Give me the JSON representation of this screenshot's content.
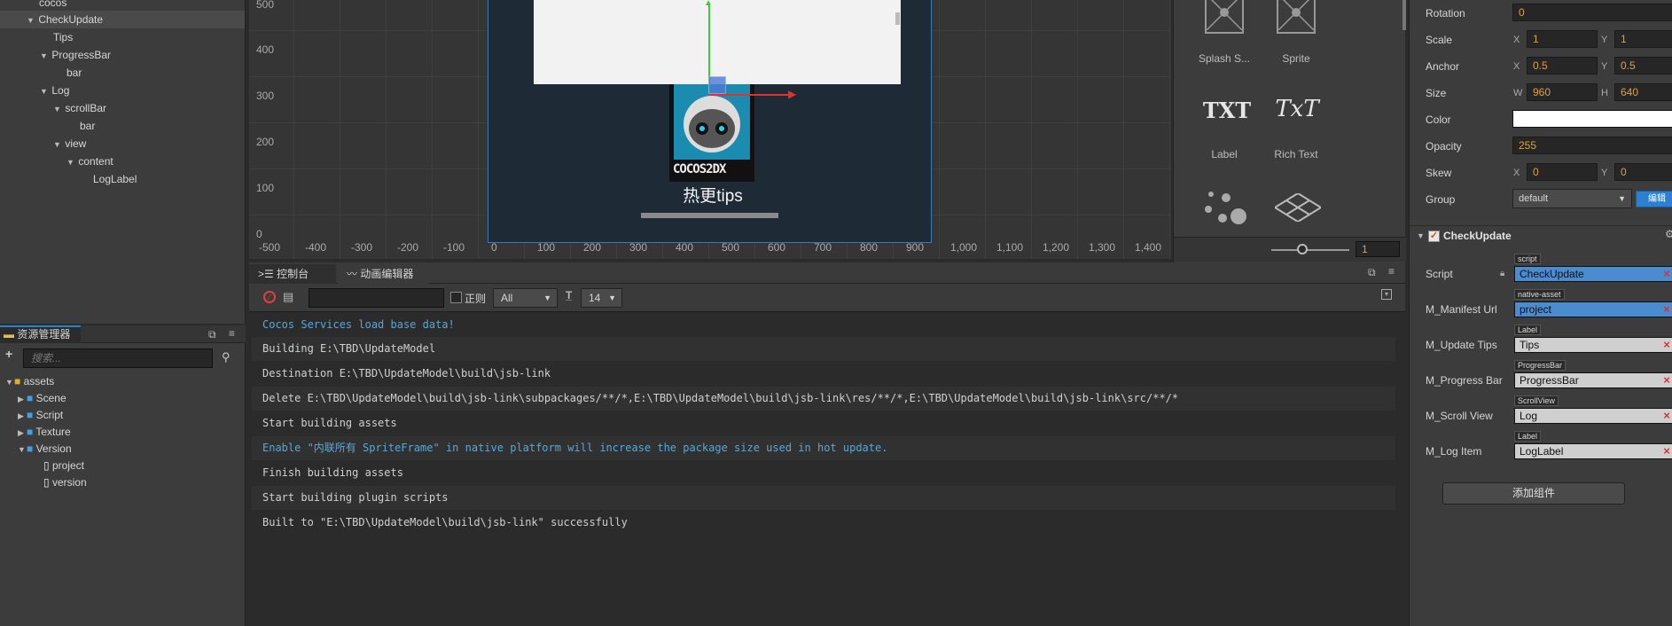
{
  "hierarchy": {
    "nodes": [
      "cocos",
      "CheckUpdate",
      "Tips",
      "ProgressBar",
      "bar",
      "Log",
      "scrollBar",
      "bar",
      "view",
      "content",
      "LogLabel"
    ]
  },
  "scene": {
    "y_labels": [
      "500",
      "400",
      "300",
      "200",
      "100",
      "0"
    ],
    "x_labels": [
      "-500",
      "-400",
      "-300",
      "-200",
      "-100",
      "0",
      "100",
      "200",
      "300",
      "400",
      "500",
      "600",
      "700",
      "800",
      "900",
      "1,000",
      "1,100",
      "1,200",
      "1,300",
      "1,400"
    ],
    "logo_text": "COCOS2DX",
    "tips_label": "热更tips"
  },
  "widgets": {
    "items": [
      "Splash S...",
      "Sprite",
      "Label",
      "Rich Text"
    ],
    "txt_glyph": "TXT",
    "richtext_glyph": "TxT",
    "zoom_value": "1"
  },
  "console": {
    "tabs": [
      "控制台",
      "动画编辑器"
    ],
    "regex_label": "正则",
    "filter_value": "All",
    "font_size_value": "14",
    "lines": [
      "Cocos Services load base data!",
      "Building E:\\TBD\\UpdateModel",
      "Destination E:\\TBD\\UpdateModel\\build\\jsb-link",
      "Delete E:\\TBD\\UpdateModel\\build\\jsb-link\\subpackages/**/*,E:\\TBD\\UpdateModel\\build\\jsb-link\\res/**/*,E:\\TBD\\UpdateModel\\build\\jsb-link\\src/**/*",
      "Start building assets",
      "Enable \"内联所有 SpriteFrame\" in native platform will increase the package size used in hot update.",
      "Finish building assets",
      "Start building plugin scripts",
      "Built to \"E:\\TBD\\UpdateModel\\build\\jsb-link\" successfully"
    ]
  },
  "assets": {
    "title": "资源管理器",
    "search_placeholder": "搜索...",
    "tree": [
      "assets",
      "Scene",
      "Script",
      "Texture",
      "Version",
      "project",
      "version"
    ]
  },
  "inspector": {
    "rotation_label": "Rotation",
    "rotation": "0",
    "scale_label": "Scale",
    "scale_x": "1",
    "scale_y": "1",
    "anchor_label": "Anchor",
    "anchor_x": "0.5",
    "anchor_y": "0.5",
    "size_label": "Size",
    "size_w": "960",
    "size_h": "640",
    "color_label": "Color",
    "opacity_label": "Opacity",
    "opacity": "255",
    "skew_label": "Skew",
    "skew_x": "0",
    "skew_y": "0",
    "group_label": "Group",
    "group": "default",
    "edit_button": "编辑",
    "x": "X",
    "y": "Y",
    "w": "W",
    "h": "H",
    "component_title": "CheckUpdate",
    "props": [
      {
        "label": "Script",
        "tag": "script",
        "value": "CheckUpdate",
        "color": "#4a8ccf"
      },
      {
        "label": "M_Manifest Url",
        "tag": "native-asset",
        "value": "project",
        "color": "#4a8ccf"
      },
      {
        "label": "M_Update Tips",
        "tag": "Label",
        "value": "Tips",
        "color": "#cfcfcf"
      },
      {
        "label": "M_Progress Bar",
        "tag": "ProgressBar",
        "value": "ProgressBar",
        "color": "#cfcfcf"
      },
      {
        "label": "M_Scroll View",
        "tag": "ScrollView",
        "value": "Log",
        "color": "#cfcfcf"
      },
      {
        "label": "M_Log Item",
        "tag": "Label",
        "value": "LogLabel",
        "color": "#cfcfcf"
      }
    ],
    "add_component_button": "添加组件"
  },
  "colors": {
    "accent": "#2d7fd0",
    "value_orange": "#e0a040",
    "error_red": "#e03030"
  }
}
